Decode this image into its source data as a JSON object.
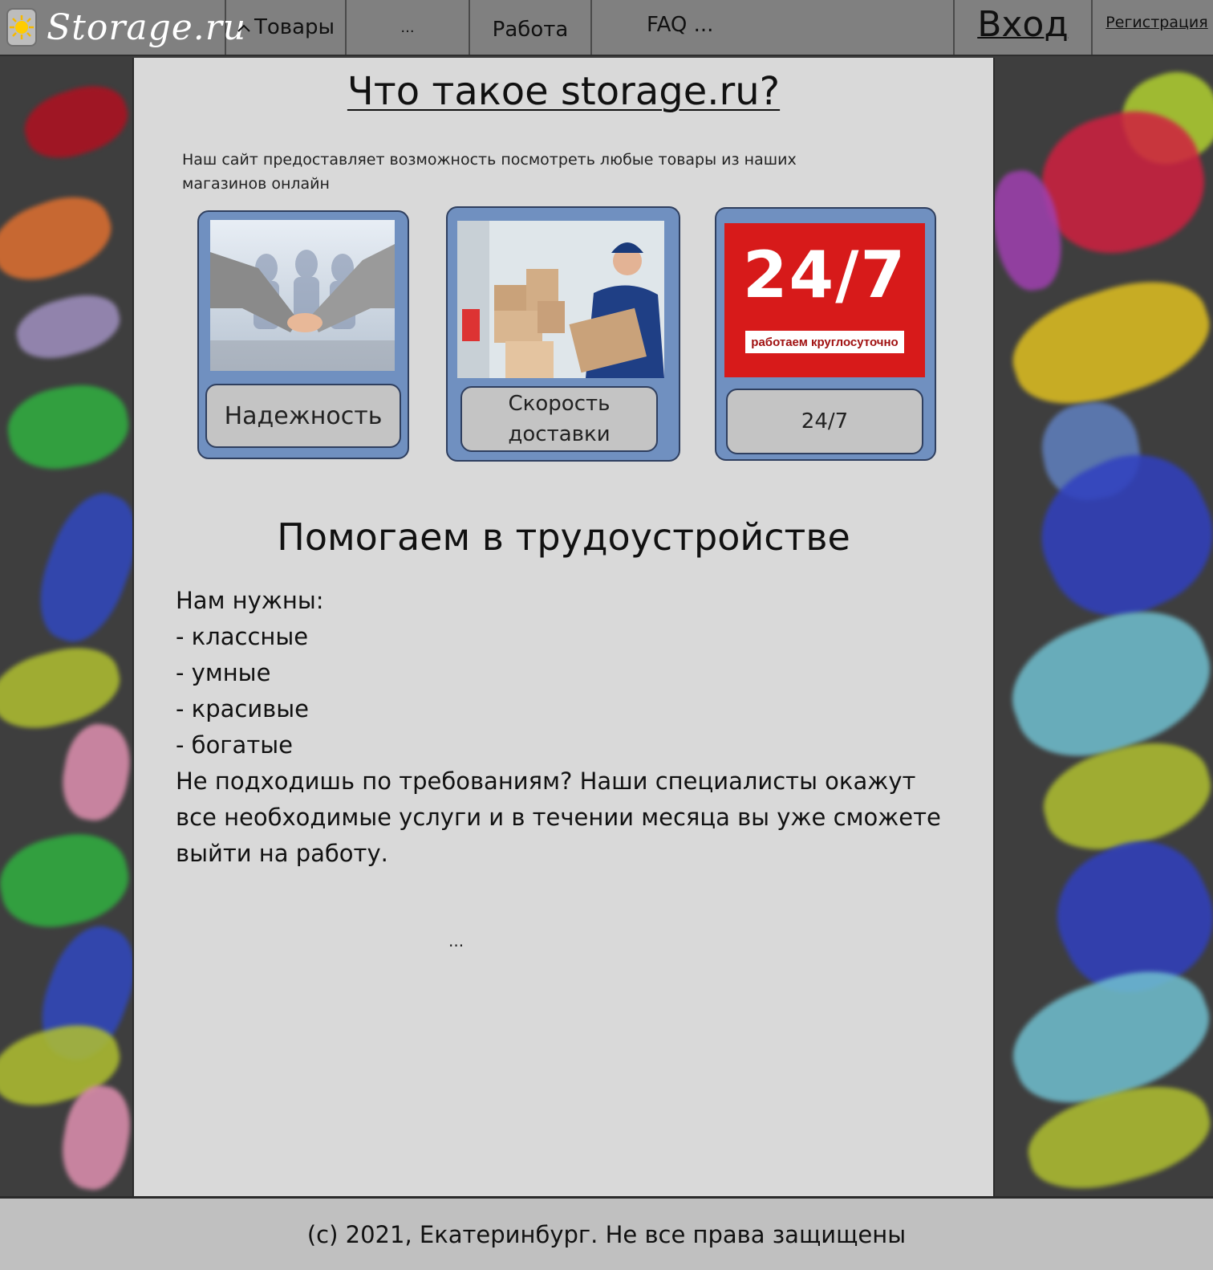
{
  "nav": {
    "logo_text": "Storage.ru",
    "goods_label": "Товары",
    "dots_label": "...",
    "work_label": "Работа",
    "faq_label": "FAQ ...",
    "login_label": "Вход",
    "register_label": "Регистрация"
  },
  "main": {
    "title": "Что такое storage.ru?",
    "intro": "Наш сайт предоставляет возможность посмотреть любые товары из наших магазинов онлайн",
    "cards": [
      {
        "label": "Надежность",
        "icon": "handshake-image"
      },
      {
        "label": "Скорость доставки",
        "icon": "delivery-image"
      },
      {
        "label": "24/7",
        "icon": "24-7-image",
        "image_title": "24/7",
        "image_caption": "работаем круглосуточно"
      }
    ],
    "subtitle": "Помогаем в трудоустройстве",
    "jobs_intro": "Нам нужны:",
    "requirements": [
      "- классные",
      "- умные",
      "- красивые",
      "- богатые"
    ],
    "jobs_text": "Не подходишь по требованиям? Наши специалисты окажут все необходимые услуги и в течении месяца вы уже сможете выйти на работу.",
    "more": "..."
  },
  "footer": {
    "text": "(с) 2021, Екатеринбург. Не все права защищены"
  },
  "colors": {
    "nav_bg": "#808080",
    "page_bg": "#3e3e3e",
    "panel_bg": "#d9d9d9",
    "card_bg": "#7090c0",
    "label_bg": "#c4c4c4",
    "footer_bg": "#c0c0c0",
    "badge_red": "#d71a1a"
  }
}
